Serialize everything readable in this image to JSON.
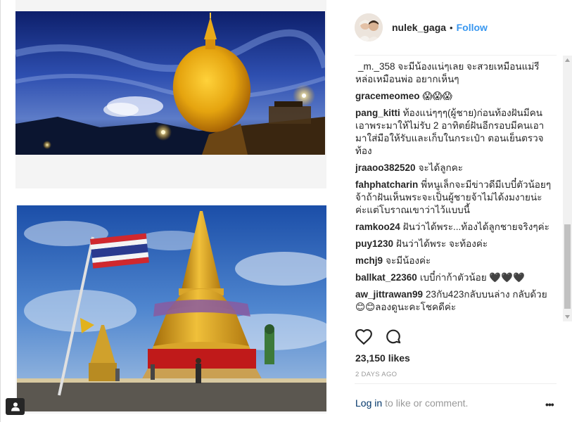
{
  "post": {
    "username": "nulek_gaga",
    "separator": "•",
    "follow_label": "Follow",
    "likes": "23,150 likes",
    "timestamp": "2 DAYS AGO",
    "login_link": "Log in",
    "login_rest": "to like or comment.",
    "more_label": "•••"
  },
  "comments": [
    {
      "author": "",
      "text": "_m._358 จะมีน้องแน่ๆเลย จะสวยเหมือนแม่รีหล่อเหมือนพ่อ อยากเห็นๆ"
    },
    {
      "author": "gracemeomeo",
      "text": "😱😱😱"
    },
    {
      "author": "pang_kitti",
      "text": "ท้องแน่ๆๆๆ(ผู้ชาย)ก่อนท้องฝันมีคนเอาพระมาให้ไม่รับ 2 อาทิตย์ฝันอีกรอบมีคนเอามาใส่มือให้รับและเก็บในกระเป๋า ตอนเย็นตรวจท้อง"
    },
    {
      "author": "jraaoo382520",
      "text": "จะได้ลูกคะ"
    },
    {
      "author": "fahphatcharin",
      "text": "พี่หนูเล็กจะมีข่าวดีมีเบบี๋ตัวน้อยๆจ้าถ้าฝันเห็นพระจะเป็นผู้ชายจ้าไม่ได้งมงายน่ะค่ะแต่โบราณเขาว่าไว้แบบนี้"
    },
    {
      "author": "ramkoo24",
      "text": "ฝันว่าได้พระ...ท้องได้ลูกชายจริงๆค่ะ"
    },
    {
      "author": "puy1230",
      "text": "ฝันว่าได้พระ จะท้องค่ะ"
    },
    {
      "author": "mchj9",
      "text": "จะมีน้องค่ะ"
    },
    {
      "author": "ballkat_22360",
      "text": "เบบี๋ก่าก้าตัวน้อย 🖤🖤🖤"
    },
    {
      "author": "aw_jittrawan99",
      "text": "23กับ423กลับบนล่าง กลับด้วย😊😊ลองดูนะคะโชคดีค่ะ"
    }
  ],
  "colors": {
    "accent_follow": "#3897f0",
    "login_link": "#003569",
    "muted": "#999999",
    "text": "#262626"
  },
  "icons": {
    "like": "heart-outline-icon",
    "comment": "speech-bubble-icon",
    "user_badge": "user-silhouette-icon"
  }
}
